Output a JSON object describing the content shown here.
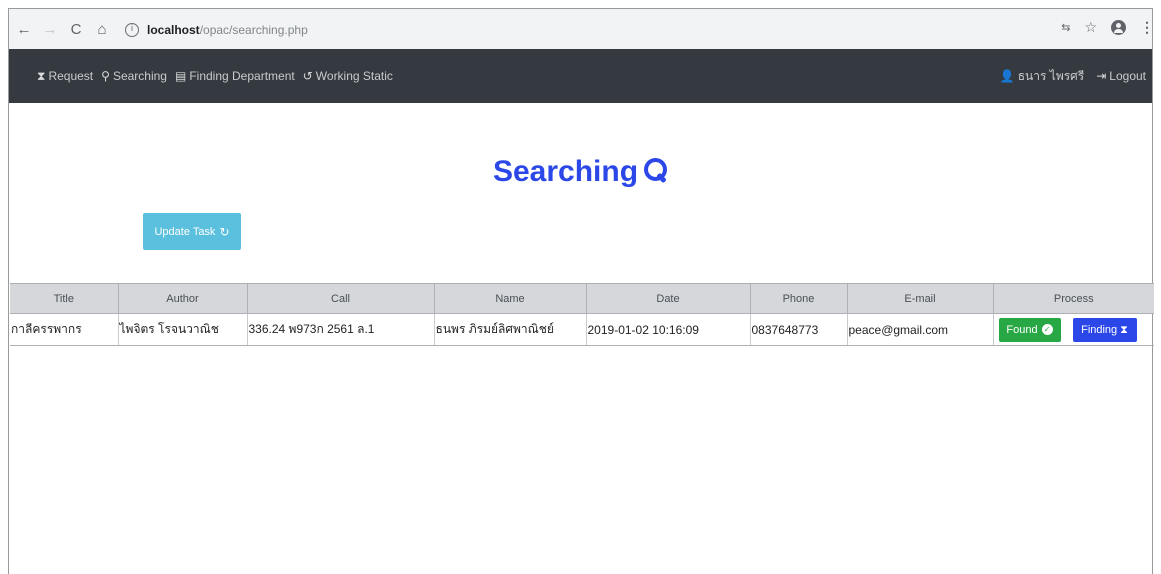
{
  "browser": {
    "url_host": "localhost",
    "url_path": "/opac/searching.php",
    "info_icon": "i",
    "ext_label": "⇆"
  },
  "navbar": {
    "links": [
      {
        "label": "Request",
        "icon": "hourglass-icon"
      },
      {
        "label": "Searching",
        "icon": "search-icon"
      },
      {
        "label": "Finding Department",
        "icon": "building-icon"
      },
      {
        "label": "Working Static",
        "icon": "history-icon"
      }
    ],
    "user_name": "ธนาร ไพรศรี",
    "logout_label": "Logout"
  },
  "main": {
    "title": "Searching",
    "update_button": "Update Task"
  },
  "table": {
    "headers": [
      "Title",
      "Author",
      "Call",
      "Name",
      "Date",
      "Phone",
      "E-mail",
      "Process"
    ],
    "rows": [
      {
        "title": "กาลีครรพากร",
        "author": "ไพจิตร โรจนวาณิช",
        "call": "336.24 พ973ก 2561 ล.1",
        "name": "ธนพร ภิรมย์ลิศพาณิชย์",
        "date": "2019-01-02 10:16:09",
        "phone": "0837648773",
        "email": "peace@gmail.com",
        "found_label": "Found",
        "finding_label": "Finding"
      }
    ]
  },
  "colors": {
    "navbar_bg": "#343a40",
    "title_blue": "#2b47e8",
    "update_btn": "#5bc0de",
    "found_btn": "#28a745",
    "finding_btn": "#2b47e8"
  }
}
